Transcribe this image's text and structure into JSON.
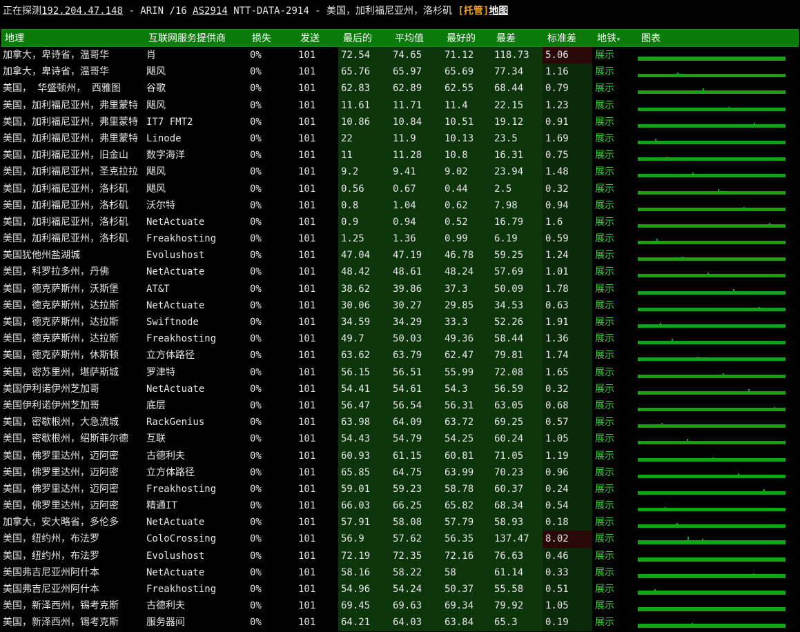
{
  "topbar": {
    "prefix": "正在探测",
    "ip": "192.204.47.148",
    "mid": " - ARIN /16 ",
    "asn": "AS2914",
    "rest": " NTT-DATA-2914 - 美国，加利福尼亚州，洛杉矶 ",
    "hosted": "[托管]",
    "map": "地图"
  },
  "columns": {
    "geo": "地理",
    "isp": "互联网服务提供商",
    "loss": "损失",
    "sent": "发送",
    "last": "最后的",
    "avg": "平均值",
    "best": "最好的",
    "worst": "最差",
    "std": "标准差",
    "map": "地铁",
    "map_arrow": "▾",
    "graph": "图表"
  },
  "rows": [
    {
      "geo": "加拿大，卑诗省，温哥华",
      "isp": "肖",
      "loss": "0%",
      "sent": "101",
      "last": "72.54",
      "avg": "74.65",
      "best": "71.12",
      "worst": "118.73",
      "std": "5.06",
      "map": "展示"
    },
    {
      "geo": "加拿大，卑诗省，温哥华",
      "isp": "飓风",
      "loss": "0%",
      "sent": "101",
      "last": "65.76",
      "avg": "65.97",
      "best": "65.69",
      "worst": "77.34",
      "std": "1.16",
      "map": "展示"
    },
    {
      "geo": "美国， 华盛顿州， 西雅图",
      "isp": "谷歌",
      "loss": "0%",
      "sent": "101",
      "last": "62.83",
      "avg": "62.89",
      "best": "62.55",
      "worst": "68.44",
      "std": "0.79",
      "map": "展示"
    },
    {
      "geo": "美国，加利福尼亚州，弗里蒙特",
      "isp": "飓风",
      "loss": "0%",
      "sent": "101",
      "last": "11.61",
      "avg": "11.71",
      "best": "11.4",
      "worst": "22.15",
      "std": "1.23",
      "map": "展示"
    },
    {
      "geo": "美国，加利福尼亚州，弗里蒙特",
      "isp": "IT7 FMT2",
      "loss": "0%",
      "sent": "101",
      "last": "10.86",
      "avg": "10.84",
      "best": "10.51",
      "worst": "19.12",
      "std": "0.91",
      "map": "展示"
    },
    {
      "geo": "美国，加利福尼亚州，弗里蒙特",
      "isp": "Linode",
      "loss": "0%",
      "sent": "101",
      "last": "22",
      "avg": "11.9",
      "best": "10.13",
      "worst": "23.5",
      "std": "1.69",
      "map": "展示"
    },
    {
      "geo": "美国，加利福尼亚州，旧金山",
      "isp": "数字海洋",
      "loss": "0%",
      "sent": "101",
      "last": "11",
      "avg": "11.28",
      "best": "10.8",
      "worst": "16.31",
      "std": "0.75",
      "map": "展示"
    },
    {
      "geo": "美国，加利福尼亚州，圣克拉拉",
      "isp": "飓风",
      "loss": "0%",
      "sent": "101",
      "last": "9.2",
      "avg": "9.41",
      "best": "9.02",
      "worst": "23.94",
      "std": "1.48",
      "map": "展示"
    },
    {
      "geo": "美国，加利福尼亚州，洛杉矶",
      "isp": "飓风",
      "loss": "0%",
      "sent": "101",
      "last": "0.56",
      "avg": "0.67",
      "best": "0.44",
      "worst": "2.5",
      "std": "0.32",
      "map": "展示"
    },
    {
      "geo": "美国，加利福尼亚州，洛杉矶",
      "isp": "沃尔特",
      "loss": "0%",
      "sent": "101",
      "last": "0.8",
      "avg": "1.04",
      "best": "0.62",
      "worst": "7.98",
      "std": "0.94",
      "map": "展示"
    },
    {
      "geo": "美国，加利福尼亚州，洛杉矶",
      "isp": "NetActuate",
      "loss": "0%",
      "sent": "101",
      "last": "0.9",
      "avg": "0.94",
      "best": "0.52",
      "worst": "16.79",
      "std": "1.6",
      "map": "展示"
    },
    {
      "geo": "美国，加利福尼亚州，洛杉矶",
      "isp": "Freakhosting",
      "loss": "0%",
      "sent": "101",
      "last": "1.25",
      "avg": "1.36",
      "best": "0.99",
      "worst": "6.19",
      "std": "0.59",
      "map": "展示"
    },
    {
      "geo": "美国犹他州盐湖城",
      "isp": "Evolushost",
      "loss": "0%",
      "sent": "101",
      "last": "47.04",
      "avg": "47.19",
      "best": "46.78",
      "worst": "59.25",
      "std": "1.24",
      "map": "展示"
    },
    {
      "geo": "美国，科罗拉多州，丹佛",
      "isp": "NetActuate",
      "loss": "0%",
      "sent": "101",
      "last": "48.42",
      "avg": "48.61",
      "best": "48.24",
      "worst": "57.69",
      "std": "1.01",
      "map": "展示"
    },
    {
      "geo": "美国，德克萨斯州，沃斯堡",
      "isp": "AT&T",
      "loss": "0%",
      "sent": "101",
      "last": "38.62",
      "avg": "39.86",
      "best": "37.3",
      "worst": "50.09",
      "std": "1.78",
      "map": "展示"
    },
    {
      "geo": "美国，德克萨斯州，达拉斯",
      "isp": "NetActuate",
      "loss": "0%",
      "sent": "101",
      "last": "30.06",
      "avg": "30.27",
      "best": "29.85",
      "worst": "34.53",
      "std": "0.63",
      "map": "展示"
    },
    {
      "geo": "美国，德克萨斯州，达拉斯",
      "isp": "Swiftnode",
      "loss": "0%",
      "sent": "101",
      "last": "34.59",
      "avg": "34.29",
      "best": "33.3",
      "worst": "52.26",
      "std": "1.91",
      "map": "展示"
    },
    {
      "geo": "美国，德克萨斯州，达拉斯",
      "isp": "Freakhosting",
      "loss": "0%",
      "sent": "101",
      "last": "49.7",
      "avg": "50.03",
      "best": "49.36",
      "worst": "58.44",
      "std": "1.36",
      "map": "展示"
    },
    {
      "geo": "美国，德克萨斯州，休斯顿",
      "isp": "立方体路径",
      "loss": "0%",
      "sent": "101",
      "last": "63.62",
      "avg": "63.79",
      "best": "62.47",
      "worst": "79.81",
      "std": "1.74",
      "map": "展示"
    },
    {
      "geo": "美国，密苏里州，堪萨斯城",
      "isp": "罗津特",
      "loss": "0%",
      "sent": "101",
      "last": "56.15",
      "avg": "56.51",
      "best": "55.99",
      "worst": "72.08",
      "std": "1.65",
      "map": "展示"
    },
    {
      "geo": "美国伊利诺伊州芝加哥",
      "isp": "NetActuate",
      "loss": "0%",
      "sent": "101",
      "last": "54.41",
      "avg": "54.61",
      "best": "54.3",
      "worst": "56.59",
      "std": "0.32",
      "map": "展示"
    },
    {
      "geo": "美国伊利诺伊州芝加哥",
      "isp": "底层",
      "loss": "0%",
      "sent": "101",
      "last": "56.47",
      "avg": "56.54",
      "best": "56.31",
      "worst": "63.05",
      "std": "0.68",
      "map": "展示"
    },
    {
      "geo": "美国，密歇根州，大急流城",
      "isp": "RackGenius",
      "loss": "0%",
      "sent": "101",
      "last": "63.98",
      "avg": "64.09",
      "best": "63.72",
      "worst": "69.25",
      "std": "0.57",
      "map": "展示"
    },
    {
      "geo": "美国，密歇根州，绍斯菲尔德",
      "isp": "互联",
      "loss": "0%",
      "sent": "101",
      "last": "54.43",
      "avg": "54.79",
      "best": "54.25",
      "worst": "60.24",
      "std": "1.05",
      "map": "展示"
    },
    {
      "geo": "美国，佛罗里达州，迈阿密",
      "isp": "古德利夫",
      "loss": "0%",
      "sent": "101",
      "last": "60.93",
      "avg": "61.15",
      "best": "60.81",
      "worst": "71.05",
      "std": "1.19",
      "map": "展示"
    },
    {
      "geo": "美国，佛罗里达州，迈阿密",
      "isp": "立方体路径",
      "loss": "0%",
      "sent": "101",
      "last": "65.85",
      "avg": "64.75",
      "best": "63.99",
      "worst": "70.23",
      "std": "0.96",
      "map": "展示"
    },
    {
      "geo": "美国，佛罗里达州，迈阿密",
      "isp": "Freakhosting",
      "loss": "0%",
      "sent": "101",
      "last": "59.01",
      "avg": "59.23",
      "best": "58.78",
      "worst": "60.37",
      "std": "0.24",
      "map": "展示"
    },
    {
      "geo": "美国，佛罗里达州，迈阿密",
      "isp": "精通IT",
      "loss": "0%",
      "sent": "101",
      "last": "66.03",
      "avg": "66.25",
      "best": "65.82",
      "worst": "68.34",
      "std": "0.54",
      "map": "展示"
    },
    {
      "geo": "加拿大，安大略省，多伦多",
      "isp": "NetActuate",
      "loss": "0%",
      "sent": "101",
      "last": "57.91",
      "avg": "58.08",
      "best": "57.79",
      "worst": "58.93",
      "std": "0.18",
      "map": "展示"
    },
    {
      "geo": "美国，纽约州，布法罗",
      "isp": "ColoCrossing",
      "loss": "0%",
      "sent": "101",
      "last": "56.9",
      "avg": "57.62",
      "best": "56.35",
      "worst": "137.47",
      "std": "8.02",
      "map": "展示"
    },
    {
      "geo": "美国，纽约州，布法罗",
      "isp": "Evolushost",
      "loss": "0%",
      "sent": "101",
      "last": "72.19",
      "avg": "72.35",
      "best": "72.16",
      "worst": "76.63",
      "std": "0.46",
      "map": "展示"
    },
    {
      "geo": "美国弗吉尼亚州阿什本",
      "isp": "NetActuate",
      "loss": "0%",
      "sent": "101",
      "last": "58.16",
      "avg": "58.22",
      "best": "58",
      "worst": "61.14",
      "std": "0.33",
      "map": "展示"
    },
    {
      "geo": "美国弗吉尼亚州阿什本",
      "isp": "Freakhosting",
      "loss": "0%",
      "sent": "101",
      "last": "54.96",
      "avg": "54.24",
      "best": "50.37",
      "worst": "55.58",
      "std": "0.51",
      "map": "展示"
    },
    {
      "geo": "美国，新泽西州，锡考克斯",
      "isp": "古德利夫",
      "loss": "0%",
      "sent": "101",
      "last": "69.45",
      "avg": "69.63",
      "best": "69.34",
      "worst": "79.92",
      "std": "1.05",
      "map": "展示"
    },
    {
      "geo": "美国，新泽西州，锡考克斯",
      "isp": "服务器间",
      "loss": "0%",
      "sent": "101",
      "last": "64.21",
      "avg": "64.03",
      "best": "63.84",
      "worst": "65.3",
      "std": "0.19",
      "map": "展示"
    }
  ]
}
